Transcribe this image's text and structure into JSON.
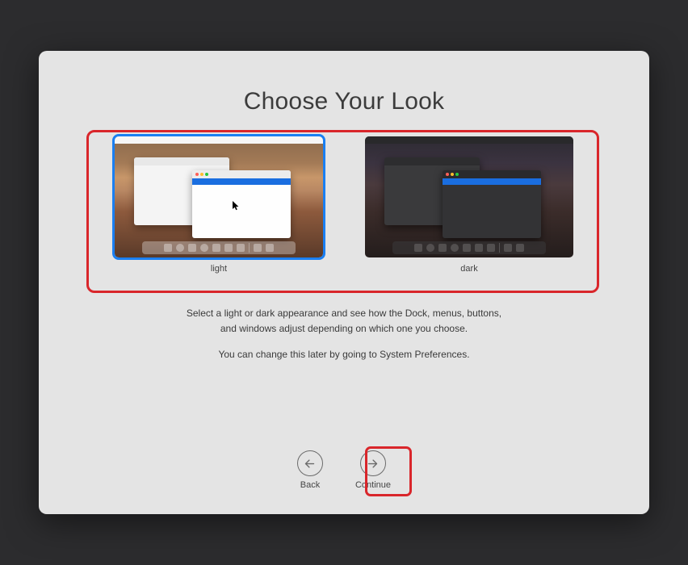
{
  "title": "Choose Your Look",
  "options": {
    "light": {
      "label": "light",
      "selected": true
    },
    "dark": {
      "label": "dark",
      "selected": false
    }
  },
  "description_line1": "Select a light or dark appearance and see how the Dock, menus, buttons,",
  "description_line2": "and windows adjust depending on which one you choose.",
  "description_note": "You can change this later by going to System Preferences.",
  "nav": {
    "back": "Back",
    "continue": "Continue"
  },
  "annotations": {
    "highlight_options": true,
    "highlight_continue": true
  }
}
